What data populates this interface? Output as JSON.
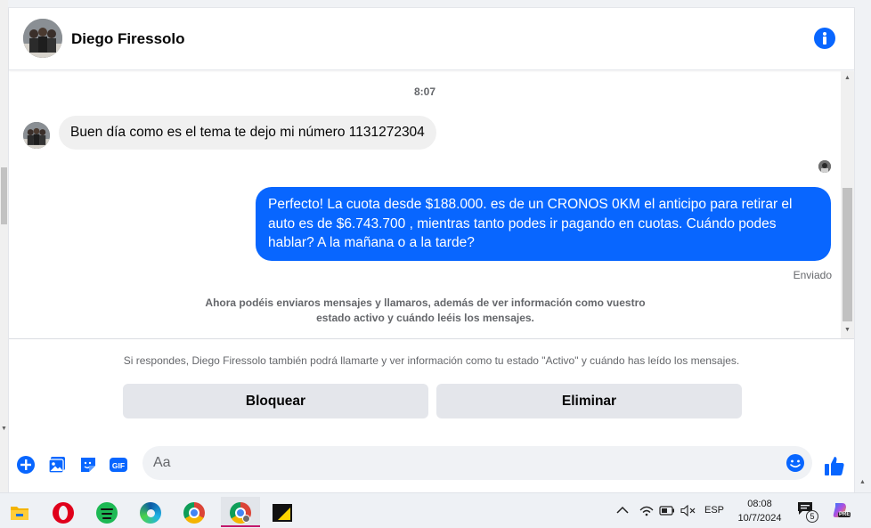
{
  "contact": {
    "name": "Diego Firessolo"
  },
  "messages": {
    "timestamp": "8:07",
    "incoming_text": "Buen día como es el tema te dejo mi número 1131272304",
    "outgoing_text": "Perfecto! La cuota desde $188.000. es de un CRONOS 0KM el anticipo para retirar el auto es de $6.743.700 , mientras tanto podes ir pagando en cuotas. Cuándo podes hablar? A la mañana o a la tarde?",
    "sent_status": "Enviado",
    "system_note": "Ahora podéis enviaros mensajes y llamaros, además de ver información como vuestro estado activo y cuándo leéis los mensajes."
  },
  "request": {
    "notice": "Si respondes, Diego Firessolo también podrá llamarte y ver información como tu estado \"Activo\" y cuándo has leído los mensajes.",
    "block_label": "Bloquear",
    "delete_label": "Eliminar"
  },
  "composer": {
    "placeholder": "Aa",
    "gif_label": "GIF"
  },
  "taskbar": {
    "language": "ESP",
    "time": "08:08",
    "date": "10/7/2024",
    "notification_count": "5",
    "copilot_badge": "PRE"
  },
  "colors": {
    "accent": "#0866ff",
    "bubble_in": "#f0f0f0",
    "button_bg": "#e4e6eb",
    "muted_text": "#65676b"
  },
  "icons": {
    "info": "info-icon",
    "add": "plus-circle-icon",
    "image": "image-icon",
    "sticker": "sticker-icon",
    "gif": "gif-icon",
    "emoji": "emoji-icon",
    "like": "thumbs-up-icon"
  }
}
